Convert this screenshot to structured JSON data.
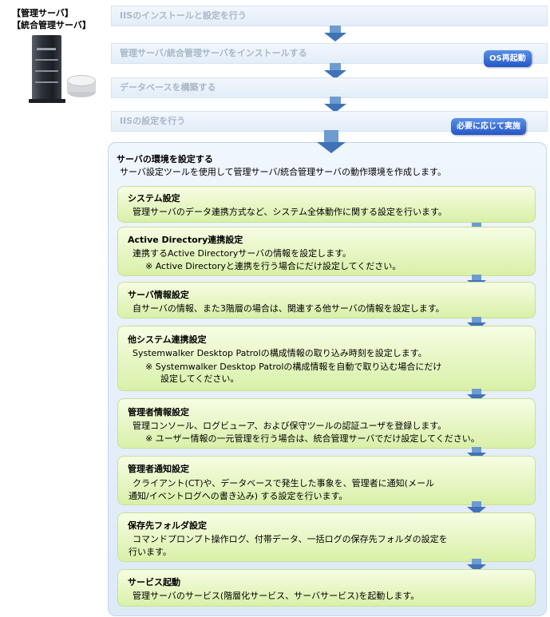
{
  "server_label": {
    "line1": "【管理サーバ】",
    "line2": "【統合管理サーバ】"
  },
  "steps": [
    {
      "label": "IISのインストールと設定を行う"
    },
    {
      "label": "管理サーバ/統合管理サーバをインストールする",
      "badge": "OS再起動"
    },
    {
      "label": "データベースを構築する"
    },
    {
      "label": "IISの設定を行う",
      "badge": "必要に応じて実施"
    }
  ],
  "main_panel": {
    "title": "サーバの環境を設定する",
    "description": "サーバ設定ツールを使用して管理サーバ/統合管理サーバの動作環境を作成します。",
    "substeps": [
      {
        "title": "システム設定",
        "lines": [
          "管理サーバのデータ連携方式など、システム全体動作に関する設定を行います。"
        ]
      },
      {
        "title": "Active Directory連携設定",
        "lines": [
          "連携するActive Directoryサーバの情報を設定します。",
          "※ Active Directoryと連携を行う場合にだけ設定してください。"
        ]
      },
      {
        "title": "サーバ情報設定",
        "lines": [
          "自サーバの情報、また3階層の場合は、関連する他サーバの情報を設定します。"
        ]
      },
      {
        "title": "他システム連携設定",
        "lines": [
          "Systemwalker Desktop Patrolの構成情報の取り込み時刻を設定します。",
          "※ Systemwalker Desktop Patrolの構成情報を自動で取り込む場合にだけ",
          "設定してください。"
        ]
      },
      {
        "title": "管理者情報設定",
        "lines": [
          "管理コンソール、ログビューア、および保守ツールの認証ユーザを登録します。",
          "※ ユーザー情報の一元管理を行う場合は、統合管理サーバでだけ設定してください。"
        ]
      },
      {
        "title": "管理者通知設定",
        "lines": [
          "クライアント(CT)や、データベースで発生した事象を、管理者に通知(メール",
          "通知/イベントログへの書き込み) する設定を行います。"
        ]
      },
      {
        "title": "保存先フォルダ設定",
        "lines": [
          "コマンドプロンプト操作ログ、付帯データ、一括ログの保存先フォルダの設定を",
          "行います。"
        ]
      },
      {
        "title": "サービス起動",
        "lines": [
          "管理サーバのサービス(階層化サービス、サーバサービス)を起動します。"
        ]
      }
    ]
  },
  "colors": {
    "step_text": "#a9b7c8",
    "arrow": "#3f73b8",
    "badge": "#2457c9",
    "panel_bg": "#e6effa",
    "substep_bg": "#d9f0a8"
  }
}
